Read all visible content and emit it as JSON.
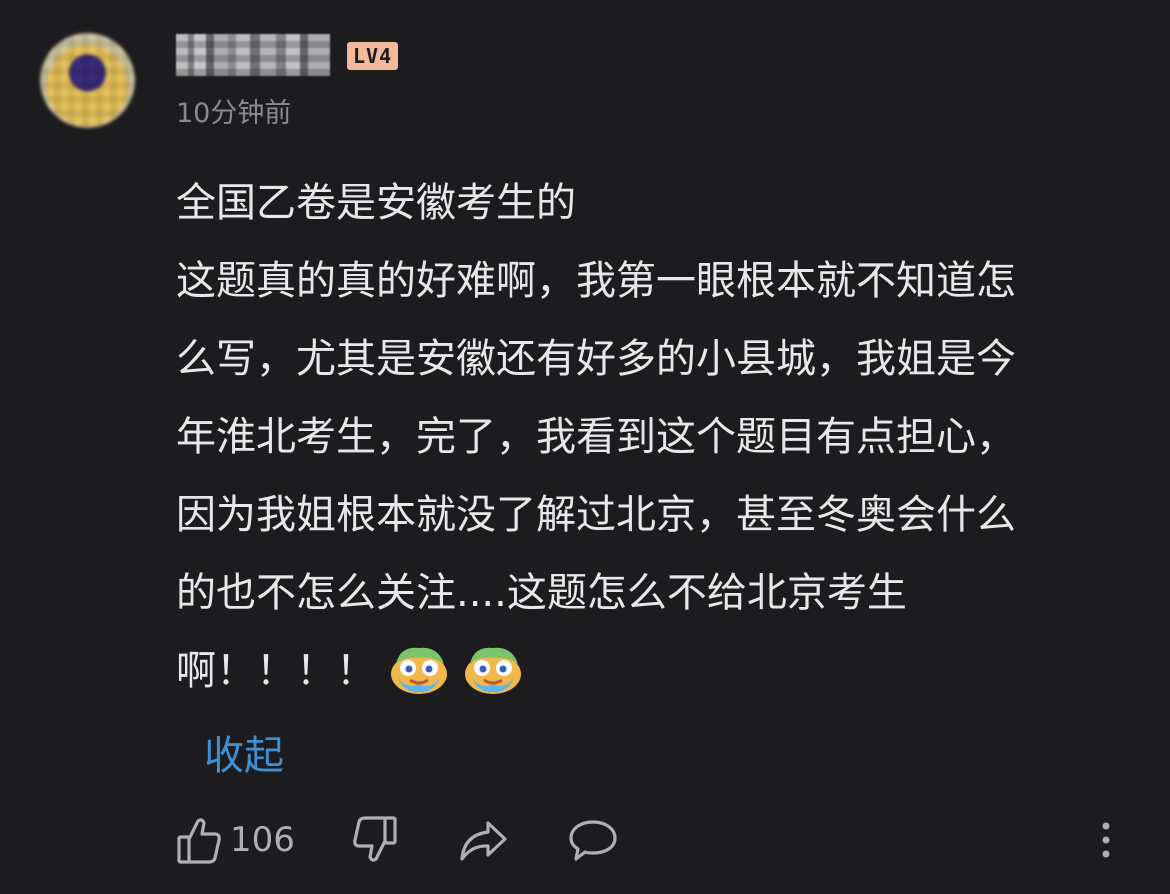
{
  "user": {
    "level_badge": "LV4"
  },
  "comment": {
    "timestamp": "10分钟前",
    "lines": [
      "全国乙卷是安徽考生的",
      "这题真的真的好难啊，我第一眼根本就不知道怎",
      "么写，尤其是安徽还有好多的小县城，我姐是今",
      "年淮北考生，完了，我看到这个题目有点担心，",
      "因为我姐根本就没了解过北京，甚至冬奥会什么",
      "的也不怎么关注....这题怎么不给北京考生",
      "啊！！！！"
    ],
    "emojis": [
      "crying-emoji",
      "crying-emoji"
    ],
    "collapse_label": "收起"
  },
  "actions": {
    "like_count": "106",
    "icons": [
      "thumbs-up-icon",
      "thumbs-down-icon",
      "share-icon",
      "reply-icon",
      "more-vertical-icon"
    ]
  },
  "colors": {
    "background": "#1c1c1e",
    "text": "#e8e8ea",
    "muted": "#8a8a8e",
    "link": "#3f8fd3",
    "badge": "#f4b89a"
  }
}
